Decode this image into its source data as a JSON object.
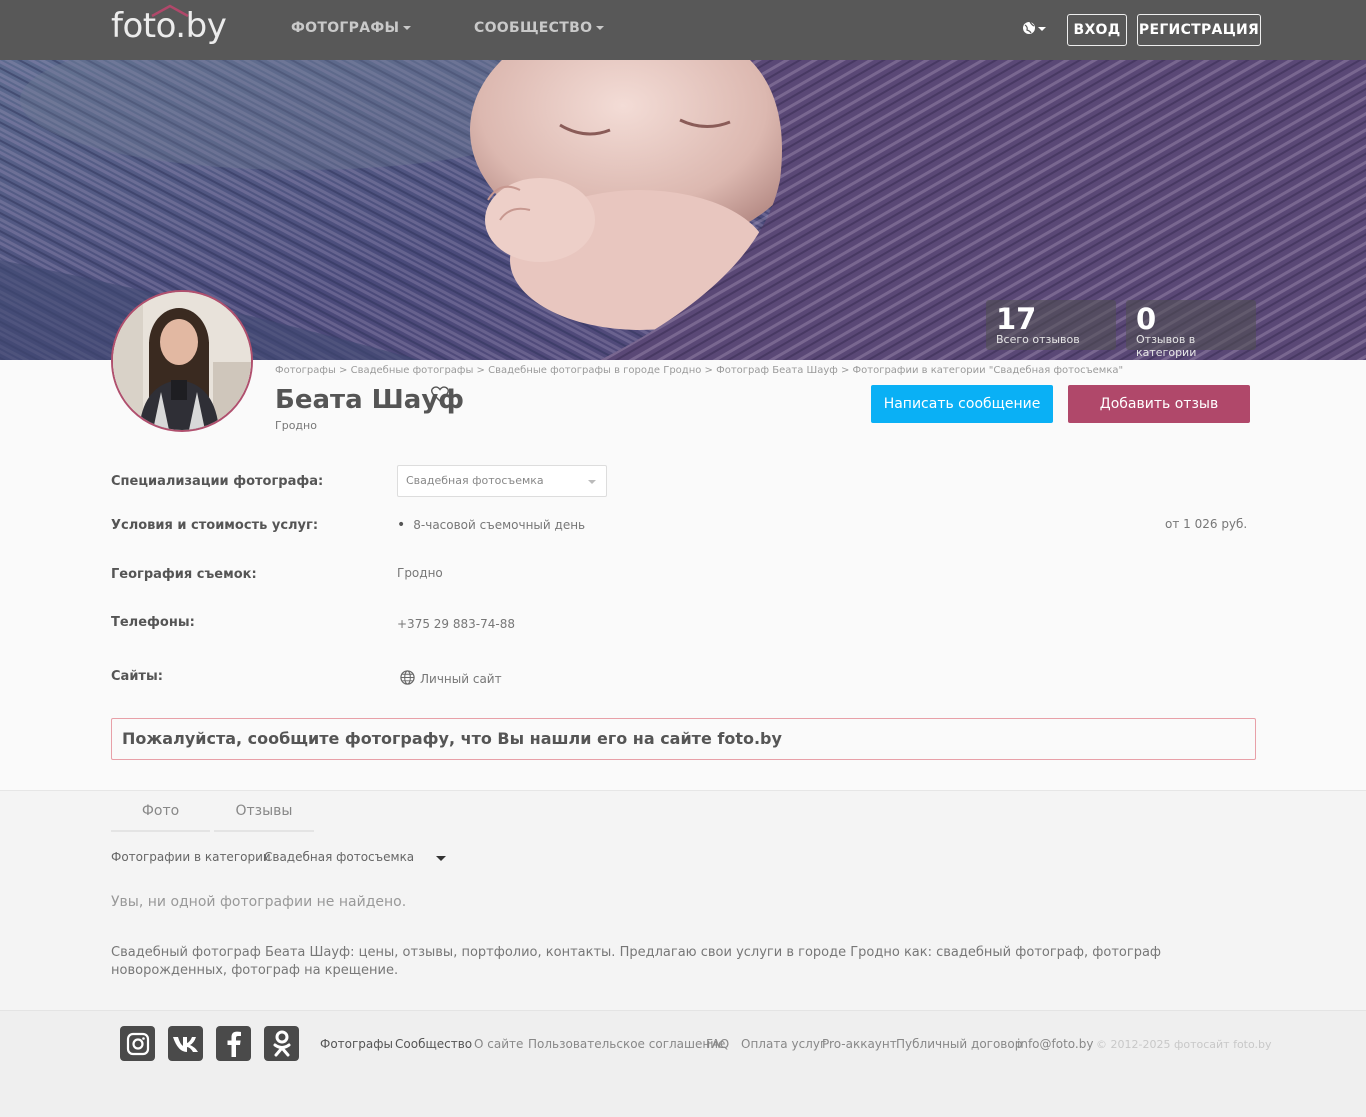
{
  "header": {
    "logo": "foto.by",
    "nav": [
      {
        "label": "ФОТОГРАФЫ"
      },
      {
        "label": "СООБЩЕСТВО"
      }
    ],
    "login": "ВХОД",
    "register": "РЕГИСТРАЦИЯ"
  },
  "stats": [
    {
      "value": "17",
      "label": "Всего отзывов"
    },
    {
      "value": "0",
      "label": "Отзывов в категории"
    }
  ],
  "profile": {
    "breadcrumb": "Фотографы > Свадебные фотографы > Свадебные фотографы в городе Гродно > Фотограф Беата Шауф > Фотографии в категории \"Свадебная фотосъемка\"",
    "name": "Беата Шауф",
    "city": "Гродно",
    "write_message": "Написать сообщение",
    "add_review": "Добавить отзыв"
  },
  "info": {
    "specializations_label": "Специализации фотографа:",
    "specialization_selected": "Свадебная фотосъемка",
    "terms_label": "Условия и стоимость услуг:",
    "service": "8-часовой съемочный день",
    "price": "от 1 026 руб.",
    "geography_label": "География съемок:",
    "geography_value": "Гродно",
    "phones_label": "Телефоны:",
    "phone": "+375 29 883-74-88",
    "sites_label": "Сайты:",
    "site": "Личный сайт"
  },
  "notice": "Пожалуйста, сообщите фотографу, что Вы нашли его на сайте foto.by",
  "tabs": [
    {
      "label": "Фото"
    },
    {
      "label": "Отзывы"
    }
  ],
  "photos": {
    "category_label": "Фотографии в категории",
    "category_selected": "Свадебная фотосъемка",
    "empty": "Увы, ни одной фотографии не найдено.",
    "description": "Свадебный фотограф Беата Шауф: цены, отзывы, портфолио, контакты. Предлагаю свои услуги в городе Гродно как: свадебный фотограф, фотограф новорожденных, фотограф на крещение."
  },
  "footer": {
    "social": [
      "instagram-icon",
      "vk-icon",
      "facebook-icon",
      "odnoklassniki-icon"
    ],
    "links": [
      {
        "label": "Фотографы"
      },
      {
        "label": "Сообщество"
      },
      {
        "label": "О сайте"
      },
      {
        "label": "Пользовательское соглашение"
      },
      {
        "label": "FAQ"
      },
      {
        "label": "Оплата услуг"
      },
      {
        "label": "Pro-аккаунт"
      },
      {
        "label": "Публичный договор"
      },
      {
        "label": "info@foto.by"
      }
    ],
    "copyright": "© 2012-2025 фотосайт foto.by"
  },
  "colors": {
    "header_bg": "#585858",
    "primary_button": "#0ab0f5",
    "review_button": "#b0486a",
    "notice_border": "#e8a0a8"
  }
}
